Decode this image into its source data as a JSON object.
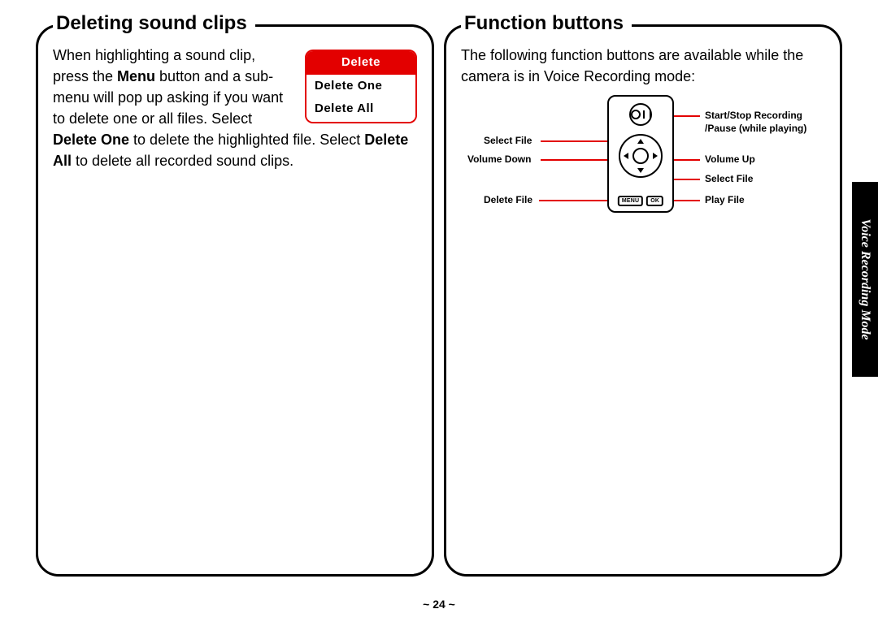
{
  "left": {
    "heading": "Deleting sound clips",
    "para_before": "When highlighting a sound clip, press the ",
    "menu_word": "Menu",
    "para_mid1": " button and a sub-menu will pop up asking if you want to delete one or all files. Select ",
    "del_one_bold": "Delete One",
    "para_mid2": " to delete the highlighted file. Select ",
    "del_all_bold": "Delete All",
    "para_after": " to delete all recorded sound clips.",
    "menu": {
      "header": "Delete",
      "item1": "Delete One",
      "item2": "Delete All"
    }
  },
  "right": {
    "heading": "Function buttons",
    "intro": "The following function buttons are available while the camera is in Voice Recording mode:",
    "labels": {
      "left_top": "Select File",
      "left_mid": "Volume Down",
      "left_bot": "Delete File",
      "right_top_a": "Start/Stop Recording",
      "right_top_b": "/Pause (while playing)",
      "right_mid_a": "Volume Up",
      "right_mid_b": "Select File",
      "right_bot": "Play File"
    },
    "controller": {
      "menu": "MENU",
      "ok": "OK"
    }
  },
  "page_number": "~ 24 ~",
  "side_tab": "Voice Recording Mode"
}
